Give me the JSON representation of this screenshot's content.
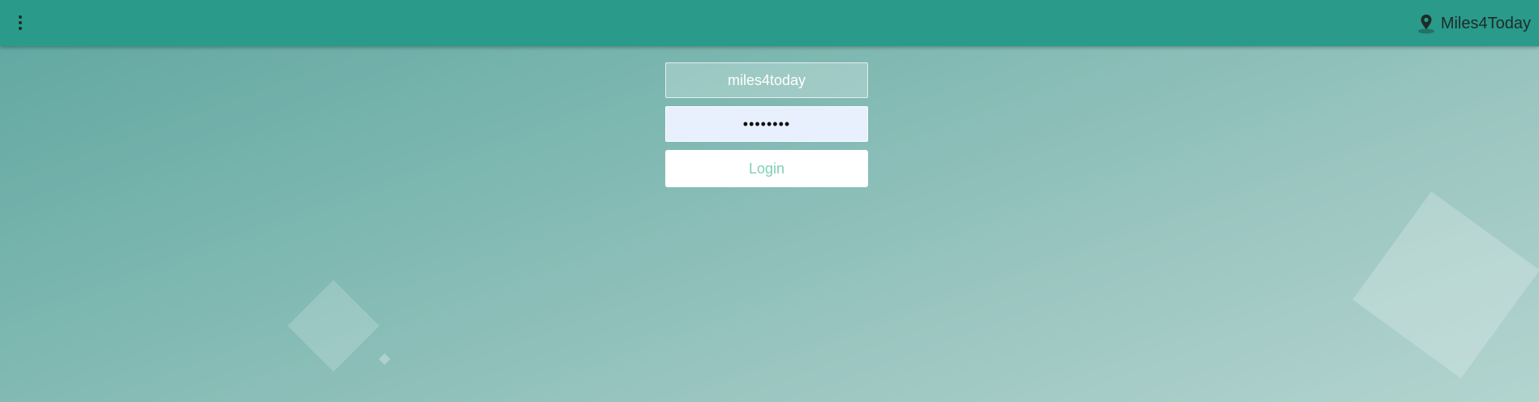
{
  "header": {
    "menu_icon": "more-vert-icon",
    "brand_icon": "location-pin-icon",
    "brand_label": "Miles4Today"
  },
  "login_form": {
    "username_value": "miles4today",
    "password_value": "••••••••",
    "login_label": "Login"
  },
  "colors": {
    "header_bg": "#2a9a8a",
    "login_text": "#7fd0b8",
    "password_field_bg": "#e8f0fe"
  }
}
